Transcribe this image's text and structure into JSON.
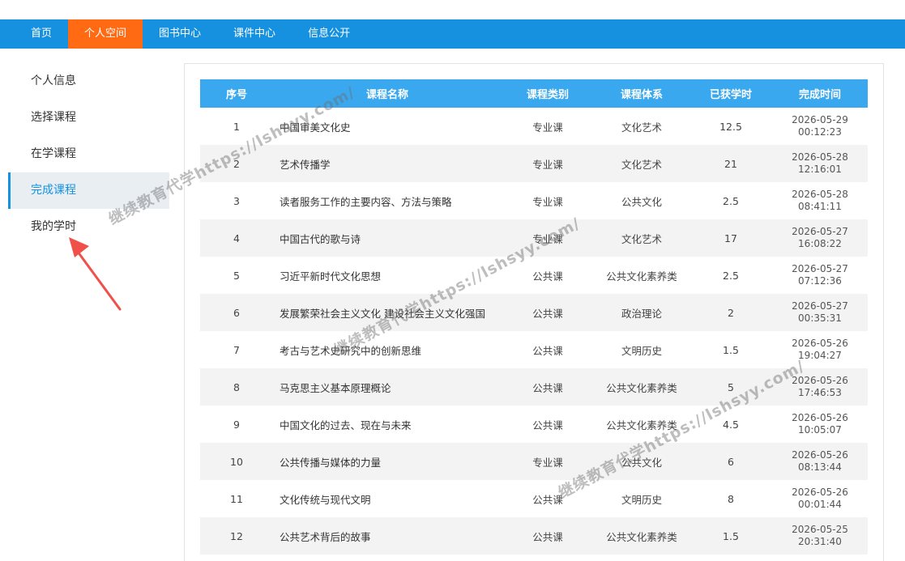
{
  "nav": {
    "items": [
      {
        "label": "首页",
        "active": false
      },
      {
        "label": "个人空间",
        "active": true
      },
      {
        "label": "图书中心",
        "active": false
      },
      {
        "label": "课件中心",
        "active": false
      },
      {
        "label": "信息公开",
        "active": false
      }
    ]
  },
  "sidebar": {
    "items": [
      {
        "label": "个人信息",
        "active": false
      },
      {
        "label": "选择课程",
        "active": false
      },
      {
        "label": "在学课程",
        "active": false
      },
      {
        "label": "完成课程",
        "active": true
      },
      {
        "label": "我的学时",
        "active": false
      }
    ]
  },
  "table": {
    "headers": [
      "序号",
      "课程名称",
      "课程类别",
      "课程体系",
      "已获学时",
      "完成时间"
    ],
    "rows": [
      {
        "no": "1",
        "name": "中国审美文化史",
        "type": "专业课",
        "system": "文化艺术",
        "hours": "12.5",
        "date": "2026-05-29",
        "time": "00:12:23"
      },
      {
        "no": "2",
        "name": "艺术传播学",
        "type": "专业课",
        "system": "文化艺术",
        "hours": "21",
        "date": "2026-05-28",
        "time": "12:16:01"
      },
      {
        "no": "3",
        "name": "读者服务工作的主要内容、方法与策略",
        "type": "专业课",
        "system": "公共文化",
        "hours": "2.5",
        "date": "2026-05-28",
        "time": "08:41:11"
      },
      {
        "no": "4",
        "name": "中国古代的歌与诗",
        "type": "专业课",
        "system": "文化艺术",
        "hours": "17",
        "date": "2026-05-27",
        "time": "16:08:22"
      },
      {
        "no": "5",
        "name": "习近平新时代文化思想",
        "type": "公共课",
        "system": "公共文化素养类",
        "hours": "2.5",
        "date": "2026-05-27",
        "time": "07:12:36"
      },
      {
        "no": "6",
        "name": "发展繁荣社会主义文化 建设社会主义文化强国",
        "type": "公共课",
        "system": "政治理论",
        "hours": "2",
        "date": "2026-05-27",
        "time": "00:35:31"
      },
      {
        "no": "7",
        "name": "考古与艺术史研究中的创新思维",
        "type": "公共课",
        "system": "文明历史",
        "hours": "1.5",
        "date": "2026-05-26",
        "time": "19:04:27"
      },
      {
        "no": "8",
        "name": "马克思主义基本原理概论",
        "type": "公共课",
        "system": "公共文化素养类",
        "hours": "5",
        "date": "2026-05-26",
        "time": "17:46:53"
      },
      {
        "no": "9",
        "name": "中国文化的过去、现在与未来",
        "type": "公共课",
        "system": "公共文化素养类",
        "hours": "4.5",
        "date": "2026-05-26",
        "time": "10:05:07"
      },
      {
        "no": "10",
        "name": "公共传播与媒体的力量",
        "type": "专业课",
        "system": "公共文化",
        "hours": "6",
        "date": "2026-05-26",
        "time": "08:13:44"
      },
      {
        "no": "11",
        "name": "文化传统与现代文明",
        "type": "公共课",
        "system": "文明历史",
        "hours": "8",
        "date": "2026-05-26",
        "time": "00:01:44"
      },
      {
        "no": "12",
        "name": "公共艺术背后的故事",
        "type": "公共课",
        "system": "公共文化素养类",
        "hours": "1.5",
        "date": "2026-05-25",
        "time": "20:31:40"
      }
    ]
  },
  "watermark": {
    "text": "继续教育代学https://lshsyy.com/"
  },
  "colors": {
    "nav_bg": "#1591e0",
    "nav_active": "#ff6a13",
    "table_header": "#3aa8ee",
    "arrow": "#f0504a"
  }
}
